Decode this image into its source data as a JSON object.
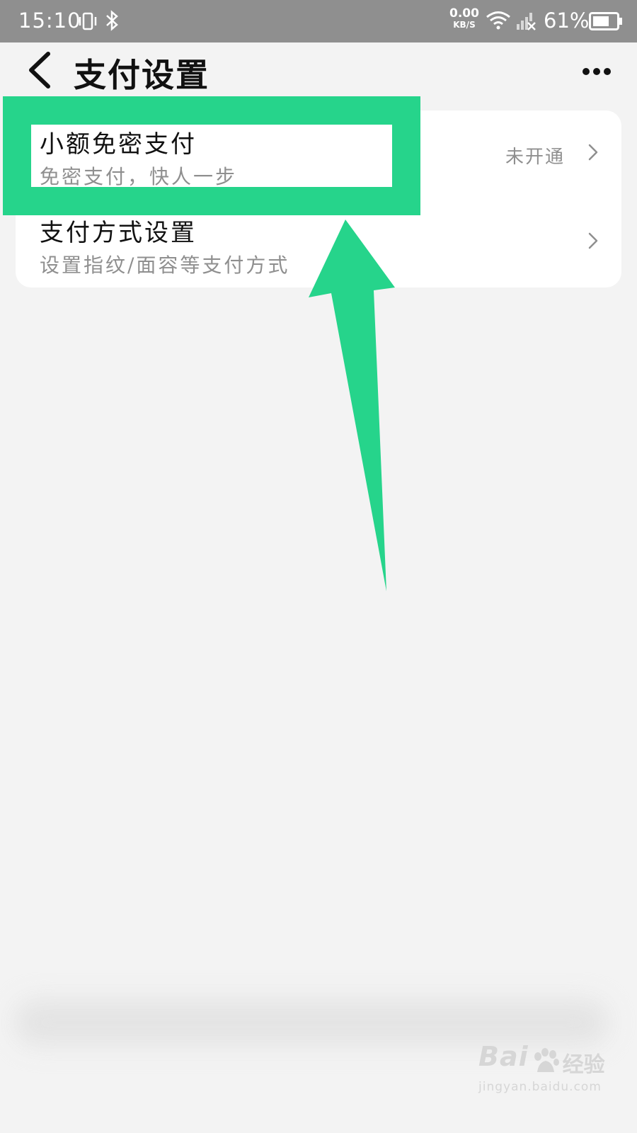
{
  "status_bar": {
    "time": "15:10",
    "net_speed_value": "0.00",
    "net_speed_unit": "KB/S",
    "battery_percent": "61%",
    "icons": [
      "vibrate-icon",
      "bluetooth-icon",
      "wifi-icon",
      "signal-icon",
      "battery-icon"
    ]
  },
  "header": {
    "title": "支付设置",
    "back_icon": "chevron-left-icon",
    "more_icon": "more-dots-icon"
  },
  "settings": {
    "items": [
      {
        "title": "小额免密支付",
        "subtitle": "免密支付，快人一步",
        "status": "未开通"
      },
      {
        "title": "支付方式设置",
        "subtitle": "设置指纹/面容等支付方式",
        "status": ""
      }
    ]
  },
  "annotation": {
    "color": "#26d48b"
  },
  "watermark": {
    "brand": "Bai",
    "brand_suffix": "经验",
    "url": "jingyan.baidu.com"
  },
  "colors": {
    "status_bar": "#8f8f8f",
    "background": "#f3f3f3",
    "card": "#ffffff",
    "secondary_text": "#8f8f8f"
  }
}
